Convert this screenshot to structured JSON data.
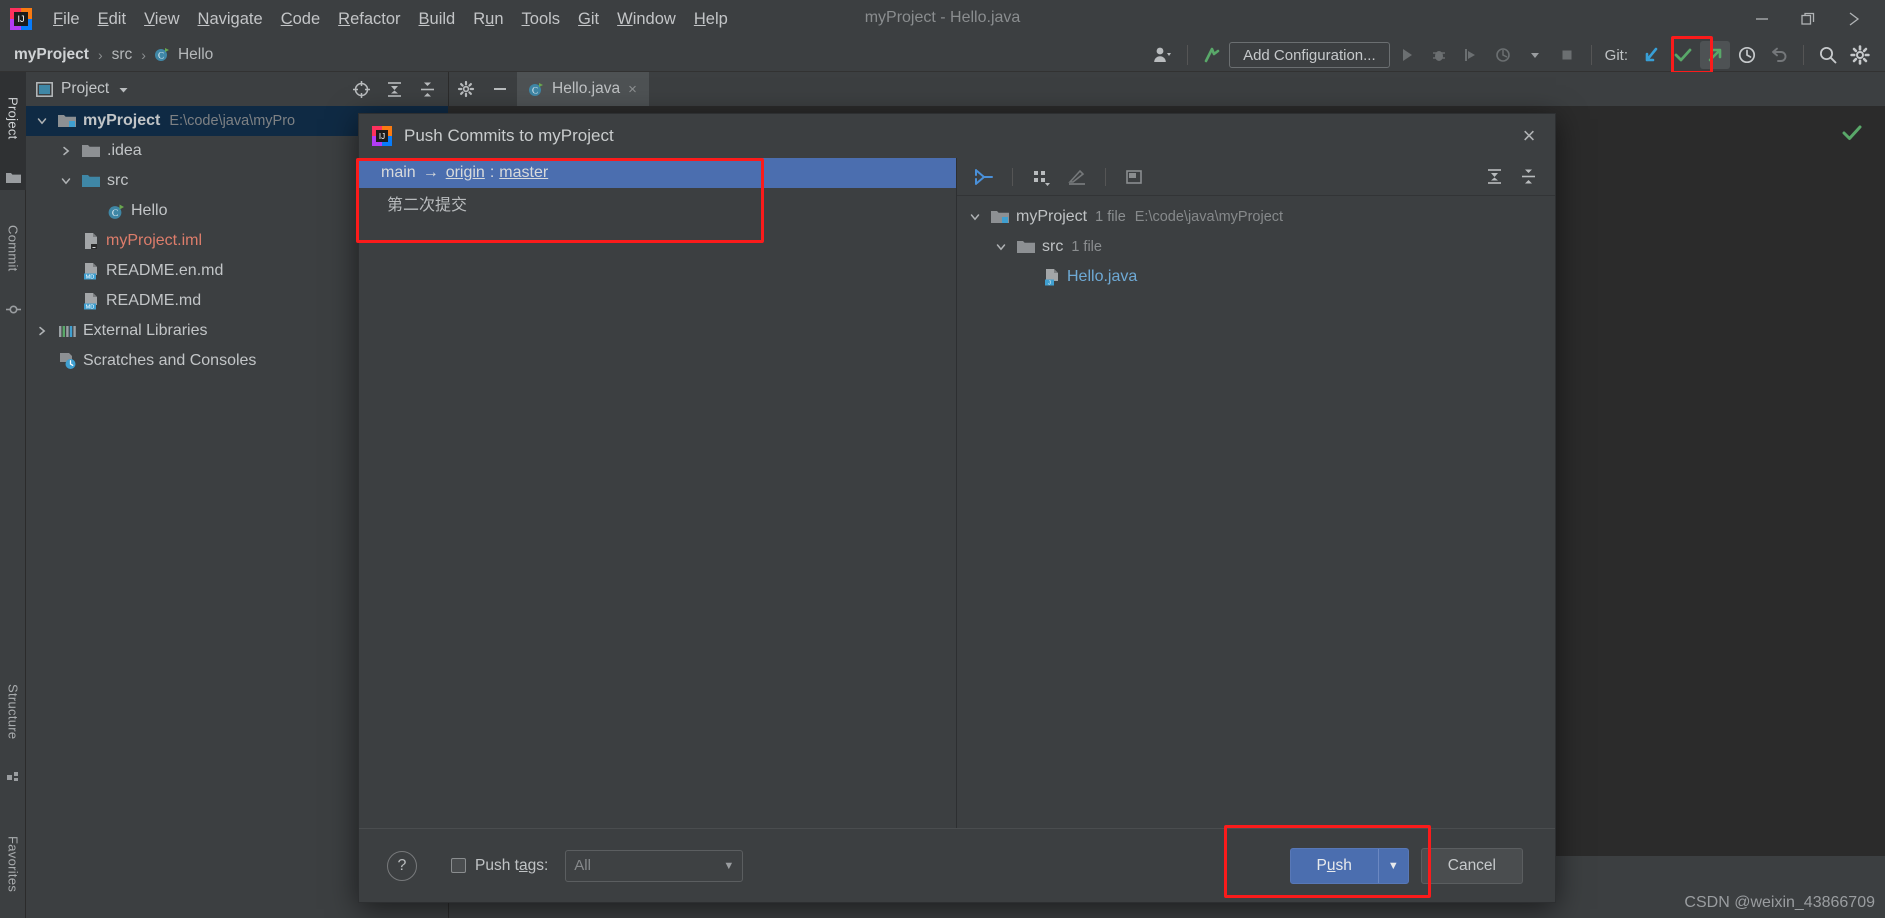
{
  "window": {
    "title": "myProject - Hello.java",
    "controls": {
      "minimize": "minimize-icon",
      "restore": "restore-icon",
      "close": "close-icon"
    }
  },
  "menubar": {
    "items": [
      {
        "label": "File",
        "mnemonic": "F"
      },
      {
        "label": "Edit",
        "mnemonic": "E"
      },
      {
        "label": "View",
        "mnemonic": "V"
      },
      {
        "label": "Navigate",
        "mnemonic": "N"
      },
      {
        "label": "Code",
        "mnemonic": "C"
      },
      {
        "label": "Refactor",
        "mnemonic": "R"
      },
      {
        "label": "Build",
        "mnemonic": "B"
      },
      {
        "label": "Run",
        "mnemonic": "u"
      },
      {
        "label": "Tools",
        "mnemonic": "T"
      },
      {
        "label": "Git",
        "mnemonic": "G"
      },
      {
        "label": "Window",
        "mnemonic": "W"
      },
      {
        "label": "Help",
        "mnemonic": "H"
      }
    ]
  },
  "navbar": {
    "breadcrumbs": [
      {
        "label": "myProject",
        "bold": true
      },
      {
        "label": "src",
        "bold": false
      },
      {
        "label": "Hello",
        "bold": false,
        "icon": "java-class-icon"
      }
    ],
    "separator": "›",
    "add_configuration": "Add Configuration...",
    "git_label": "Git:",
    "icons": [
      "user-account-icon",
      "update-project-icon",
      "run-icon",
      "debug-icon",
      "run-with-coverage-icon",
      "profiler-icon",
      "dropdown-icon",
      "stop-icon",
      "git-update-icon",
      "git-commit-icon",
      "git-push-icon",
      "history-icon",
      "rollback-icon",
      "search-icon",
      "settings-icon"
    ]
  },
  "stripe": {
    "left": [
      {
        "label": "Project",
        "icon": "project-icon",
        "active": true
      },
      {
        "label": "Commit",
        "icon": "commit-icon",
        "active": false
      },
      {
        "label": "Structure",
        "icon": "structure-icon",
        "active": false
      },
      {
        "label": "Favorites",
        "icon": "favorites-icon",
        "active": false
      }
    ]
  },
  "project_panel": {
    "title": "Project",
    "toolbar_icons": [
      "select-opened-file-icon",
      "expand-all-icon",
      "collapse-all-icon",
      "settings-gear-icon",
      "hide-icon"
    ],
    "tree": [
      {
        "label": "myProject",
        "path": "E:\\code\\java\\myPro",
        "indent": 0,
        "arrow": "v",
        "icon": "module-folder-icon",
        "selected": true,
        "bold": true,
        "color": "normal"
      },
      {
        "label": ".idea",
        "path": "",
        "indent": 1,
        "arrow": ">",
        "icon": "folder-icon",
        "selected": false,
        "bold": false,
        "color": "normal"
      },
      {
        "label": "src",
        "path": "",
        "indent": 1,
        "arrow": "v",
        "icon": "source-folder-icon",
        "selected": false,
        "bold": false,
        "color": "normal"
      },
      {
        "label": "Hello",
        "path": "",
        "indent": 2,
        "arrow": "",
        "icon": "java-class-icon",
        "selected": false,
        "bold": false,
        "color": "normal"
      },
      {
        "label": "myProject.iml",
        "path": "",
        "indent": 1,
        "arrow": "",
        "icon": "iml-file-icon",
        "selected": false,
        "bold": false,
        "color": "iml"
      },
      {
        "label": "README.en.md",
        "path": "",
        "indent": 1,
        "arrow": "",
        "icon": "markdown-file-icon",
        "selected": false,
        "bold": false,
        "color": "normal"
      },
      {
        "label": "README.md",
        "path": "",
        "indent": 1,
        "arrow": "",
        "icon": "markdown-file-icon",
        "selected": false,
        "bold": false,
        "color": "normal"
      },
      {
        "label": "External Libraries",
        "path": "",
        "indent": 0,
        "arrow": ">",
        "icon": "libraries-icon",
        "selected": false,
        "bold": false,
        "color": "normal"
      },
      {
        "label": "Scratches and Consoles",
        "path": "",
        "indent": 0,
        "arrow": "",
        "icon": "scratches-icon",
        "selected": false,
        "bold": false,
        "color": "normal"
      }
    ]
  },
  "editor": {
    "tab_label": "Hello.java",
    "tab_close": "×",
    "tab_icon": "java-class-icon",
    "status_check": "inspection-ok-icon",
    "watermark": "CSDN @weixin_43866709"
  },
  "dialog": {
    "title": "Push Commits to myProject",
    "icon": "intellij-idea-icon",
    "close_label": "×",
    "commits": {
      "branch_source": "main",
      "branch_arrow": "→",
      "branch_remote": "origin",
      "branch_colon": ":",
      "branch_target": "master",
      "messages": [
        "第二次提交"
      ]
    },
    "files_toolbar_icons": [
      "expand-diff-icon",
      "group-by-icon",
      "edit-icon",
      "preview-diff-icon",
      "expand-all-icon",
      "collapse-all-icon"
    ],
    "files_tree": [
      {
        "label": "myProject",
        "count": "1 file",
        "path": "E:\\code\\java\\myProject",
        "indent": 0,
        "arrow": "v",
        "icon": "module-folder-icon",
        "link": false
      },
      {
        "label": "src",
        "count": "1 file",
        "path": "",
        "indent": 1,
        "arrow": "v",
        "icon": "folder-icon",
        "link": false
      },
      {
        "label": "Hello.java",
        "count": "",
        "path": "",
        "indent": 2,
        "arrow": "",
        "icon": "java-file-icon",
        "link": true
      }
    ],
    "footer": {
      "help_label": "?",
      "push_tags_label_a": "Push t",
      "push_tags_label_u": "a",
      "push_tags_label_b": "gs:",
      "push_tags_checked": false,
      "tags_combo_value": "All",
      "push_label_a": "P",
      "push_label_u": "u",
      "push_label_b": "sh",
      "push_dropdown": "▼",
      "cancel_label": "Cancel"
    }
  },
  "colors": {
    "accent_blue": "#4b6eaf",
    "highlight_red": "#fb1b1b",
    "panel_bg": "#3c3f41",
    "editor_bg": "#2b2b2b",
    "selection_navy": "#0f2a44",
    "link_blue": "#6ea9d4",
    "iml_red": "#dd7d6b",
    "green": "#59a869"
  }
}
